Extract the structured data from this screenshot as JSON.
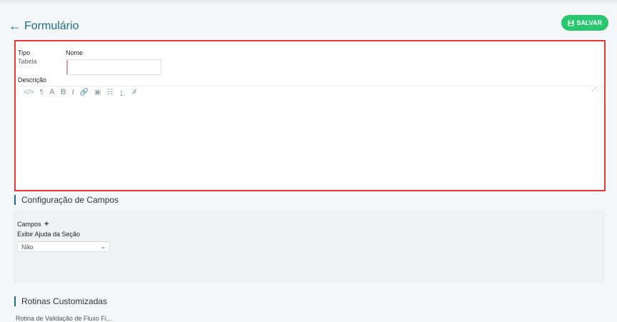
{
  "header": {
    "back_icon": "←",
    "title": "Formulário"
  },
  "toolbar": {
    "save_label": "SALVAR"
  },
  "form": {
    "tipo_label": "Tipo",
    "tipo_value": "Tabela",
    "nome_label": "Nome",
    "nome_value": "",
    "descricao_label": "Descrição",
    "editor_tools": {
      "code": "</>",
      "paragraph": "¶",
      "font": "A",
      "bold": "B",
      "italic": "I",
      "link": "🔗",
      "image": "▣",
      "unordered_list": "☷",
      "ordered_list": "⒈",
      "clear": "✗",
      "expand": "⤢"
    }
  },
  "sections": {
    "config_title": "Configuração de Campos",
    "campos_label": "Campos",
    "campos_add": "+",
    "ajuda_label": "Exibir Ajuda da Seção",
    "ajuda_value": "Não",
    "rotinas_title": "Rotinas Customizadas",
    "rotinas_cut": "Rotina de Validação de Fluxo Fi..."
  },
  "colors": {
    "accent": "#1c6f86",
    "save_green": "#28c76f",
    "highlight_red": "#e53935"
  }
}
